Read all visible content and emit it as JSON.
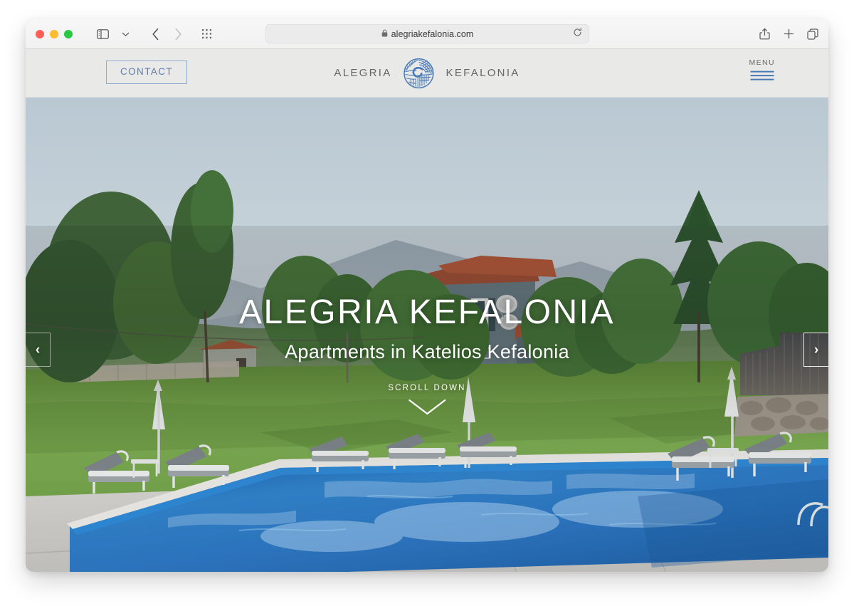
{
  "browser": {
    "traffic_lights": [
      "close",
      "minimize",
      "maximize"
    ],
    "url": "alegriakefalonia.com",
    "secure_icon": "lock-icon",
    "reload_icon": "reload-icon",
    "sidebar_icon": "sidebar-icon",
    "sidebar_chevron_icon": "chevron-down-icon",
    "back_icon": "chevron-left-icon",
    "forward_icon": "chevron-right-icon",
    "tab_grid_icon": "grid-icon",
    "share_icon": "share-icon",
    "new_tab_icon": "plus-icon",
    "tab_overview_icon": "tab-overview-icon"
  },
  "site_header": {
    "contact_label": "CONTACT",
    "brand_left": "ALEGRIA",
    "brand_right": "KEFALONIA",
    "logo_icon": "nautilus-shell-logo-icon",
    "menu_label": "MENU",
    "menu_icon": "hamburger-menu-icon"
  },
  "hero": {
    "title": "ALEGRIA KEFALONIA",
    "subtitle": "Apartments in Katelios Kefalonia",
    "scroll_label": "SCROLL DOWN",
    "scroll_icon": "chevron-down-icon",
    "prev_icon": "chevron-left-icon",
    "next_icon": "chevron-right-icon",
    "prev_glyph": "‹",
    "next_glyph": "›",
    "alt": "Swimming pool with sun loungers, lawn and apartment building in Katelios, Kefalonia"
  },
  "colors": {
    "brand_blue": "#4a7ab5",
    "contact_border": "#8fa9cd",
    "contact_text": "#5f7eae",
    "header_bg": "#e9e9e7",
    "hero_overlay_text": "#ffffff"
  }
}
